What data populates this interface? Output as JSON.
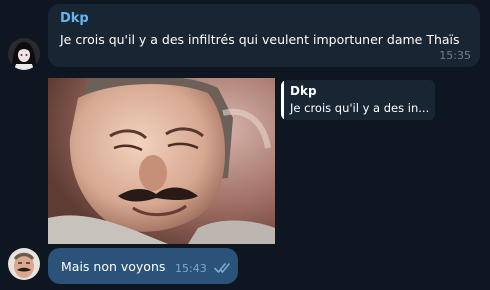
{
  "messages": [
    {
      "sender": "Dkp",
      "text": "Je crois qu'il y a des infiltrés qui veulent importuner dame Thaïs",
      "time": "15:35"
    }
  ],
  "sticker": {
    "reply": {
      "sender": "Dkp",
      "preview": "Je crois qu'il y a des in..."
    }
  },
  "outgoing": {
    "text": "Mais non voyons",
    "time": "15:43",
    "status_icon": "double-check-icon"
  },
  "colors": {
    "background": "#0e1621",
    "incoming_bubble": "#182533",
    "outgoing_bubble": "#2b5278",
    "sender_name": "#64b5ef"
  }
}
